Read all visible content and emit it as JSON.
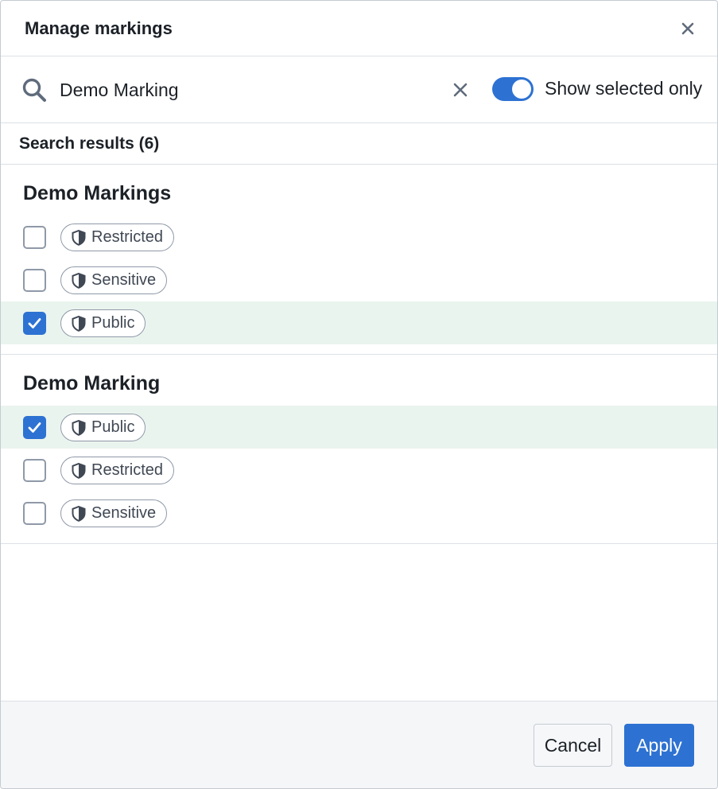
{
  "dialog": {
    "title": "Manage markings"
  },
  "search": {
    "value": "Demo Marking",
    "placeholder": "Search markings",
    "toggle_label": "Show selected only",
    "toggle_on": true
  },
  "results": {
    "heading": "Search results (6)",
    "groups": [
      {
        "title": "Demo Markings",
        "items": [
          {
            "label": "Restricted",
            "checked": false
          },
          {
            "label": "Sensitive",
            "checked": false
          },
          {
            "label": "Public",
            "checked": true
          }
        ]
      },
      {
        "title": "Demo Marking",
        "items": [
          {
            "label": "Public",
            "checked": true
          },
          {
            "label": "Restricted",
            "checked": false
          },
          {
            "label": "Sensitive",
            "checked": false
          }
        ]
      }
    ]
  },
  "footer": {
    "cancel_label": "Cancel",
    "apply_label": "Apply"
  },
  "colors": {
    "accent": "#2d72d2",
    "selected_row": "#eaf4ee",
    "border": "#dce0e5",
    "footer_bg": "#f5f6f8"
  },
  "icons": {
    "close": "close-icon",
    "search": "search-icon",
    "clear": "clear-icon",
    "marking": "shield-icon",
    "check": "checkmark-icon"
  }
}
